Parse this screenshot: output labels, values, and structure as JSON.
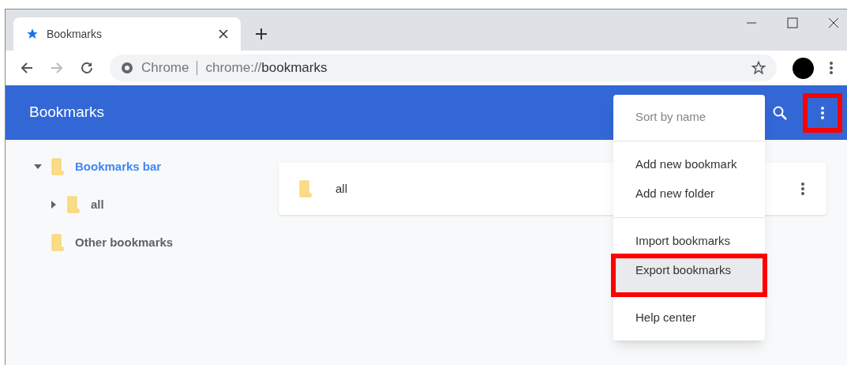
{
  "browser": {
    "tab": {
      "title": "Bookmarks"
    },
    "address": {
      "site": "Chrome",
      "url_prefix": "chrome://",
      "url_host": "bookmarks"
    }
  },
  "header": {
    "title": "Bookmarks",
    "menu_button_highlighted": true
  },
  "tree": [
    {
      "label": "Bookmarks bar",
      "selected": true,
      "expandable": true,
      "expanded": true,
      "children": [
        {
          "label": "all",
          "selected": false,
          "expandable": true,
          "expanded": false
        }
      ]
    },
    {
      "label": "Other bookmarks",
      "selected": false,
      "expandable": false
    }
  ],
  "list": [
    {
      "title": "all"
    }
  ],
  "menu": [
    {
      "label": "Sort by name",
      "disabled": true,
      "selected": false,
      "highlighted": false,
      "divider_after": true
    },
    {
      "label": "Add new bookmark",
      "disabled": false,
      "selected": false,
      "highlighted": false,
      "divider_after": false
    },
    {
      "label": "Add new folder",
      "disabled": false,
      "selected": false,
      "highlighted": false,
      "divider_after": true
    },
    {
      "label": "Import bookmarks",
      "disabled": false,
      "selected": false,
      "highlighted": false,
      "divider_after": false
    },
    {
      "label": "Export bookmarks",
      "disabled": false,
      "selected": true,
      "highlighted": true,
      "divider_after": true
    },
    {
      "label": "Help center",
      "disabled": false,
      "selected": false,
      "highlighted": false,
      "divider_after": false
    }
  ]
}
